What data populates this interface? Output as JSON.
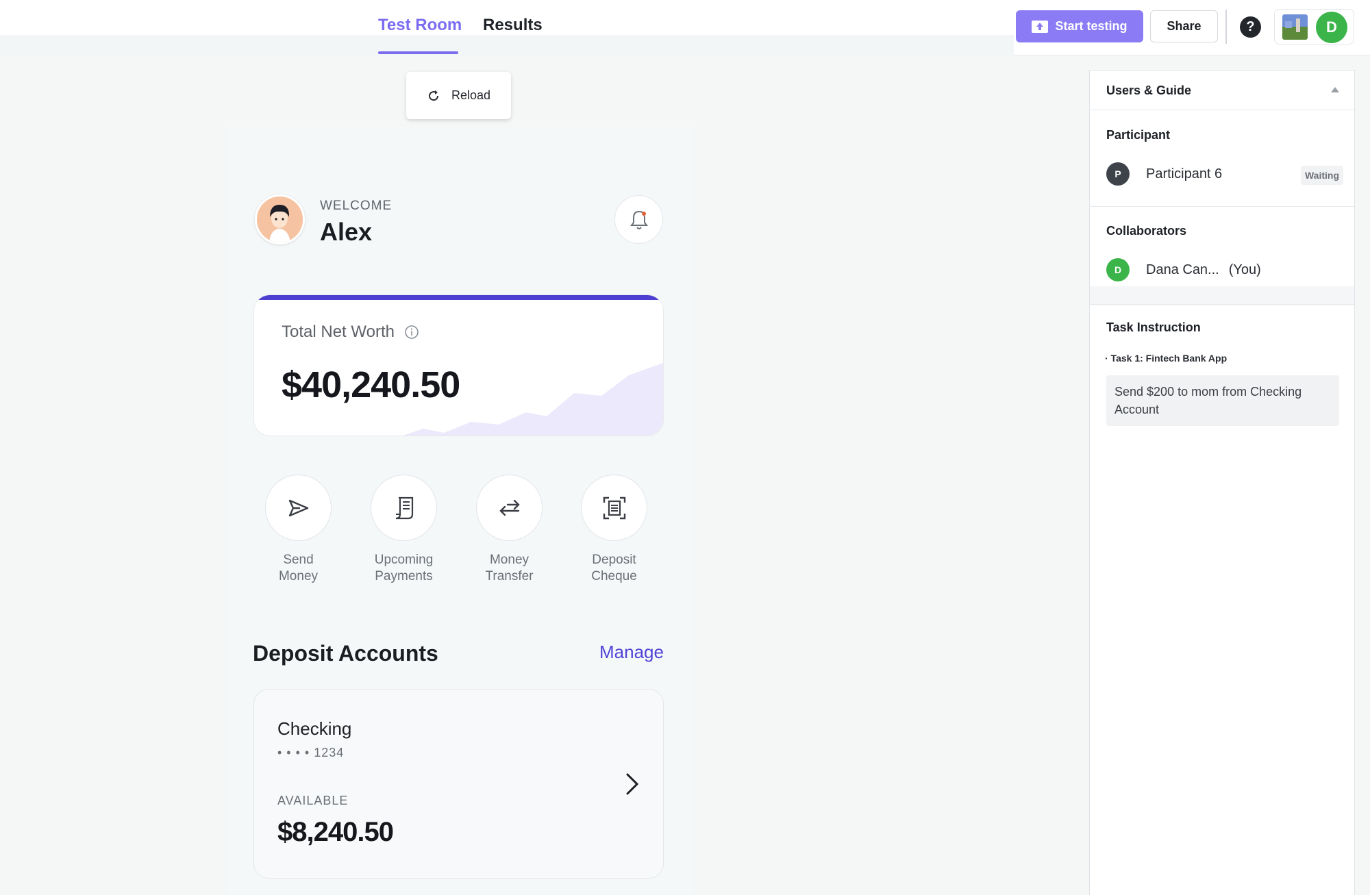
{
  "topbar": {
    "tabs": [
      {
        "label": "Test Room",
        "active": true
      },
      {
        "label": "Results",
        "active": false
      }
    ],
    "start_testing_label": "Start testing",
    "share_label": "Share",
    "help_label": "?",
    "user_initial": "D",
    "accent_color": "#8b7cf6"
  },
  "reload": {
    "label": "Reload"
  },
  "app": {
    "welcome_label": "WELCOME",
    "user_name": "Alex",
    "networth": {
      "label": "Total Net Worth",
      "value": "$40,240.50"
    },
    "actions": [
      {
        "line1": "Send",
        "line2": "Money",
        "icon": "send-icon"
      },
      {
        "line1": "Upcoming",
        "line2": "Payments",
        "icon": "receipt-icon"
      },
      {
        "line1": "Money",
        "line2": "Transfer",
        "icon": "transfer-arrows-icon"
      },
      {
        "line1": "Deposit",
        "line2": "Cheque",
        "icon": "scan-document-icon"
      }
    ],
    "deposit_title": "Deposit Accounts",
    "manage_label": "Manage",
    "account": {
      "name": "Checking",
      "number": "• • • • 1234",
      "available_label": "AVAILABLE",
      "balance": "$8,240.50"
    }
  },
  "sidepanel": {
    "title": "Users & Guide",
    "participant_heading": "Participant",
    "participant": {
      "initial": "P",
      "name": "Participant 6",
      "status": "Waiting"
    },
    "collaborators_heading": "Collaborators",
    "collaborator": {
      "initial": "D",
      "name": "Dana Can...",
      "suffix": "(You)"
    },
    "task_heading": "Task Instruction",
    "task_name": "· Task 1: Fintech Bank App",
    "task_text": "Send $200 to mom from Checking Account"
  }
}
